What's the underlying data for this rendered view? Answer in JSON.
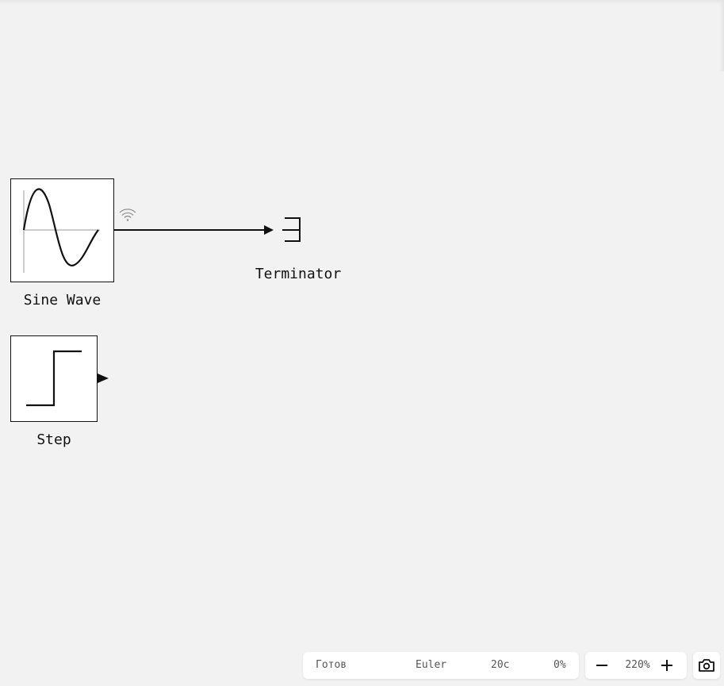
{
  "blocks": {
    "sine_wave": {
      "label": "Sine Wave"
    },
    "terminator": {
      "label": "Terminator"
    },
    "step": {
      "label": "Step"
    }
  },
  "signal_icon": "wifi-signal-icon",
  "status_bar": {
    "state": "Готов",
    "solver": "Euler",
    "stop_time": "20с",
    "progress": "0%"
  },
  "zoom": {
    "minus_label": "—",
    "value": "220%",
    "plus_label": "+"
  },
  "snapshot_icon": "camera-icon"
}
